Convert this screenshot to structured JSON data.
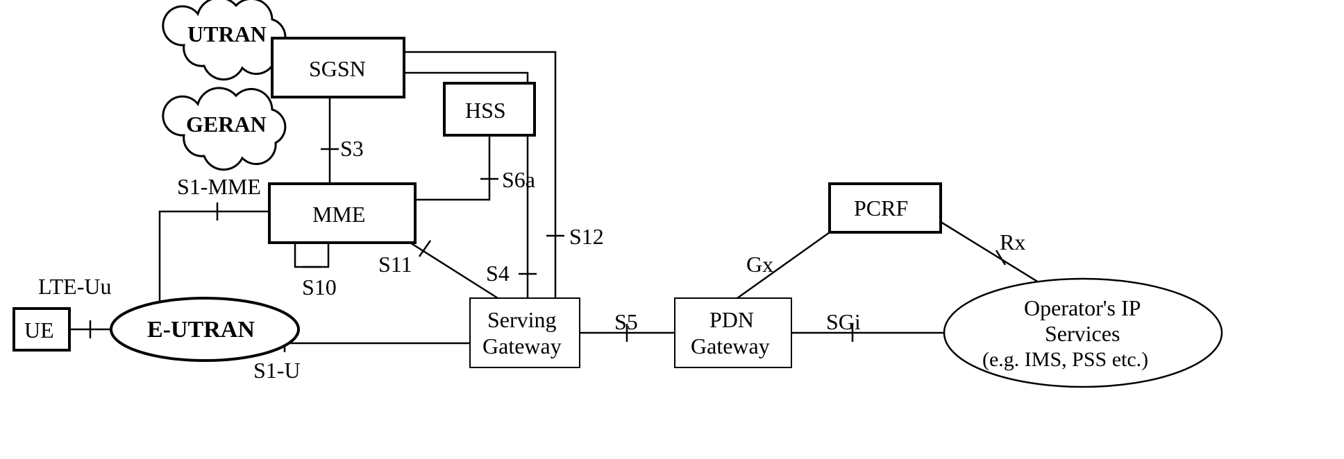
{
  "nodes": {
    "ue": "UE",
    "eutran": "E-UTRAN",
    "utran": "UTRAN",
    "geran": "GERAN",
    "sgsn": "SGSN",
    "mme": "MME",
    "hss": "HSS",
    "sgw": {
      "l1": "Serving",
      "l2": "Gateway"
    },
    "pgw": {
      "l1": "PDN",
      "l2": "Gateway"
    },
    "pcrf": "PCRF",
    "op": {
      "l1": "Operator's IP",
      "l2": "Services",
      "l3": "(e.g. IMS, PSS etc.)"
    }
  },
  "interfaces": {
    "lteuu": "LTE-Uu",
    "s1mme": "S1-MME",
    "s1u": "S1-U",
    "s3": "S3",
    "s4": "S4",
    "s5": "S5",
    "s6a": "S6a",
    "s10": "S10",
    "s11": "S11",
    "s12": "S12",
    "gx": "Gx",
    "rx": "Rx",
    "sgi": "SGi"
  }
}
